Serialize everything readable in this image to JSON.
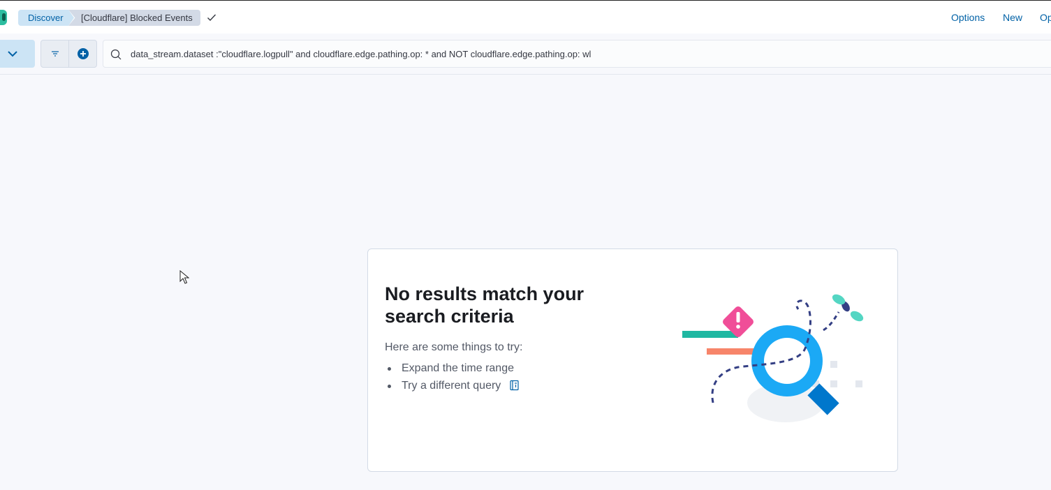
{
  "breadcrumbs": {
    "root": "Discover",
    "current": "[Cloudflare] Blocked Events"
  },
  "top_nav": {
    "options": "Options",
    "new": "New",
    "open": "Op"
  },
  "query_bar": {
    "query": "data_stream.dataset :\"cloudflare.logpull\" and cloudflare.edge.pathing.op: * and NOT cloudflare.edge.pathing.op: wl"
  },
  "empty_state": {
    "title": "No results match your search criteria",
    "intro": "Here are some things to try:",
    "tips": [
      "Expand the time range",
      "Try a different query"
    ]
  },
  "colors": {
    "accent": "#0061a6",
    "app_icon": "#2dbda0",
    "magnifier": "#1ba9f5",
    "warning": "#f04e98"
  }
}
